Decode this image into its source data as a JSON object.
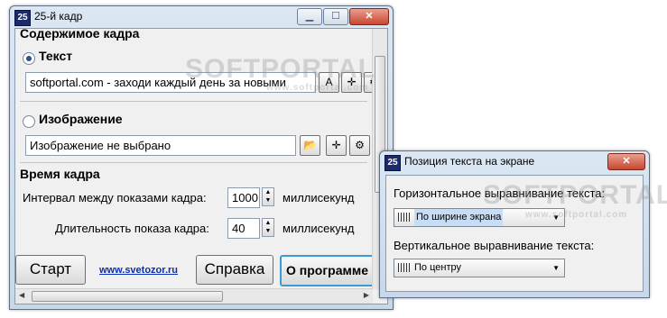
{
  "main_window": {
    "title": "25-й кадр",
    "content_header": "Содержимое кадра",
    "text_option": {
      "label": "Текст",
      "value": "softportal.com - заходи каждый день за новыми"
    },
    "image_option": {
      "label": "Изображение",
      "value": "Изображение не выбрано"
    },
    "timing": {
      "header": "Время кадра",
      "interval_label": "Интервал между показами кадра:",
      "interval_value": "1000",
      "interval_unit": "миллисекунд",
      "duration_label": "Длительность показа кадра:",
      "duration_value": "40",
      "duration_unit": "миллисекунд"
    },
    "buttons": {
      "start": "Старт",
      "help": "Справка",
      "about": "О программе"
    },
    "link": "www.svetozor.ru"
  },
  "position_window": {
    "title": "Позиция текста на экране",
    "horizontal_label": "Горизонтальное выравнивание текста:",
    "horizontal_value": "По ширине экрана",
    "vertical_label": "Вертикальное выравнивание текста:",
    "vertical_value": "По центру"
  },
  "watermark": {
    "logo": "SOFTPORTAL",
    "url": "www.softportal.com"
  },
  "icons": [
    "app-icon",
    "minimize-icon",
    "maximize-icon",
    "close-icon",
    "font-icon",
    "crosshair-icon",
    "gears-icon",
    "folder-open-icon",
    "spin-up-icon",
    "spin-down-icon",
    "dropdown-arrow-icon"
  ]
}
